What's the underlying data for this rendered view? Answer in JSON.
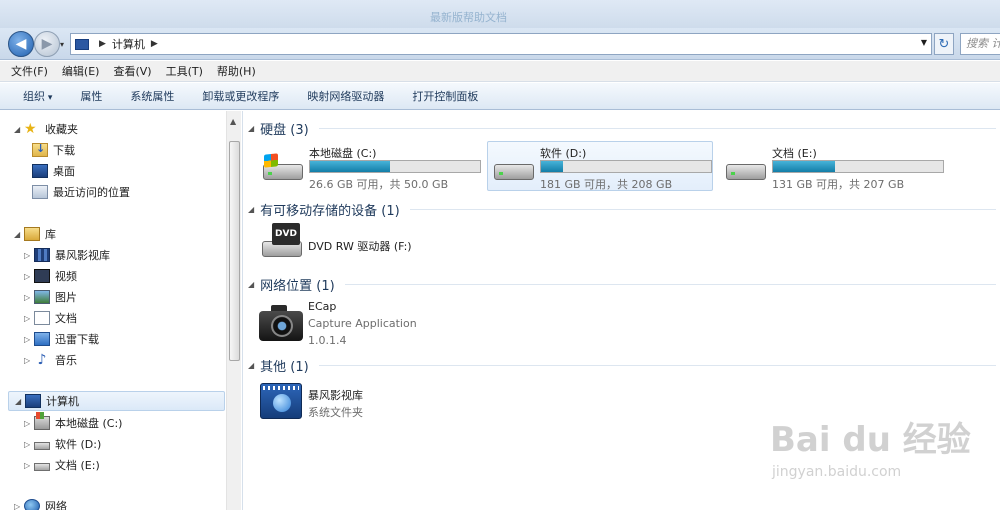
{
  "window": {
    "title": "最新版帮助文档"
  },
  "address": {
    "crumb": "计算机",
    "search_placeholder": "搜索 计"
  },
  "menu": [
    "文件(F)",
    "编辑(E)",
    "查看(V)",
    "工具(T)",
    "帮助(H)"
  ],
  "toolbar": [
    "组织",
    "属性",
    "系统属性",
    "卸载或更改程序",
    "映射网络驱动器",
    "打开控制面板"
  ],
  "nav": {
    "favorites": {
      "label": "收藏夹",
      "items": [
        "下载",
        "桌面",
        "最近访问的位置"
      ]
    },
    "libraries": {
      "label": "库",
      "items": [
        "暴风影视库",
        "视频",
        "图片",
        "文档",
        "迅雷下载",
        "音乐"
      ]
    },
    "computer": {
      "label": "计算机",
      "items": [
        "本地磁盘 (C:)",
        "软件 (D:)",
        "文档 (E:)"
      ]
    },
    "network": {
      "label": "网络"
    }
  },
  "groups": {
    "hdd": "硬盘 (3)",
    "removable": "有可移动存储的设备 (1)",
    "network": "网络位置 (1)",
    "other": "其他 (1)"
  },
  "drives": [
    {
      "name": "本地磁盘 (C:)",
      "free": "26.6 GB 可用，共 50.0 GB",
      "used_fraction": 0.468
    },
    {
      "name": "软件 (D:)",
      "free": "181 GB 可用，共 208 GB",
      "used_fraction": 0.13
    },
    {
      "name": "文档 (E:)",
      "free": "131 GB 可用，共 207 GB",
      "used_fraction": 0.367
    }
  ],
  "dvd": {
    "name": "DVD RW 驱动器 (F:)",
    "badge": "DVD"
  },
  "netloc": {
    "name": "ECap",
    "desc": "Capture Application",
    "version": "1.0.1.4"
  },
  "other": {
    "name": "暴风影视库",
    "desc": "系统文件夹"
  },
  "watermark": {
    "main": "Bai du 经验",
    "sub": "jingyan.baidu.com"
  }
}
